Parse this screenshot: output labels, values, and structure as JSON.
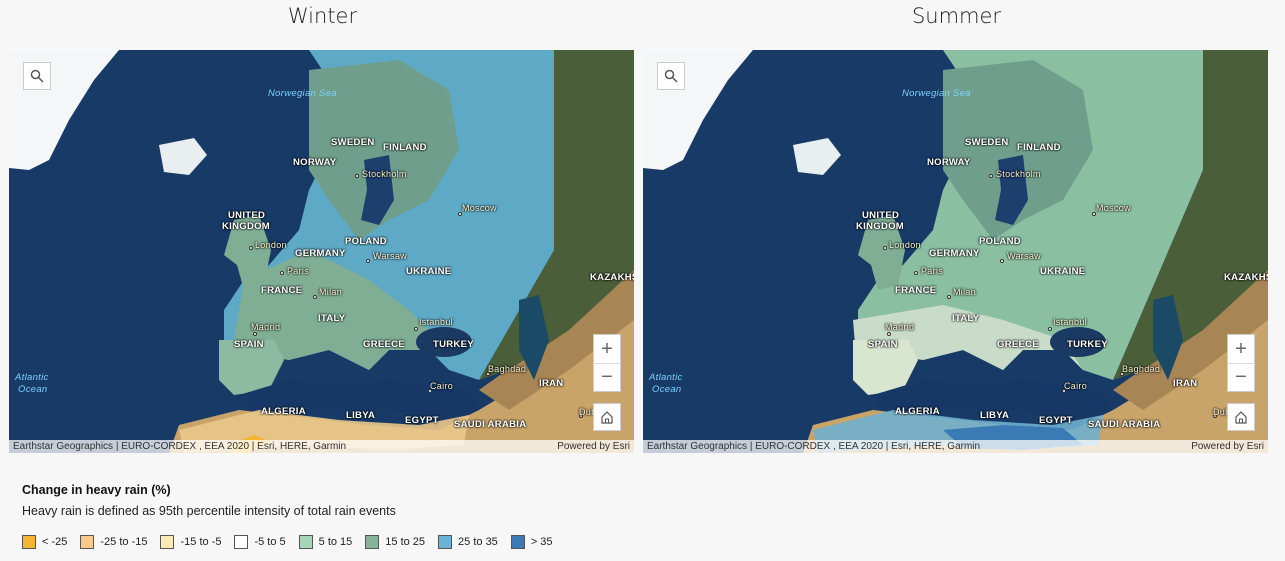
{
  "panels": [
    {
      "title": "Winter",
      "search_icon": "search-icon",
      "attribution": "Earthstar Geographics | EURO-CORDEX , EEA 2020 | Esri, HERE, Garmin",
      "powered_by": "Powered by Esri",
      "zoom_in": "+",
      "zoom_out": "−",
      "home_icon": "home-icon",
      "overlay_main_class": "25 to 35",
      "overlay_south_class": "< -25"
    },
    {
      "title": "Summer",
      "search_icon": "search-icon",
      "attribution": "Earthstar Geographics | EURO-CORDEX , EEA 2020 | Esri, HERE, Garmin",
      "powered_by": "Powered by Esri",
      "zoom_in": "+",
      "zoom_out": "−",
      "home_icon": "home-icon",
      "overlay_main_class": "5 to 15",
      "overlay_south_class": "25 to 35"
    }
  ],
  "map_labels": {
    "norwegian_sea": "Norwegian Sea",
    "sweden": "SWEDEN",
    "finland": "FINLAND",
    "norway": "NORWAY",
    "stockholm": "Stockholm",
    "moscow": "Moscow",
    "united": "UNITED",
    "kingdom": "KINGDOM",
    "london": "London",
    "poland": "POLAND",
    "germany": "GERMANY",
    "warsaw": "Warsaw",
    "paris": "Paris",
    "ukraine": "UKRAINE",
    "kazakh": "KAZAKHS",
    "france": "FRANCE",
    "milan": "Milan",
    "italy": "ITALY",
    "istanbul": "Istanbul",
    "madrid": "Madrid",
    "spain": "SPAIN",
    "greece": "GREECE",
    "turkey": "TURKEY",
    "atlantic": "Atlantic",
    "ocean": "Ocean",
    "baghdad": "Baghdad",
    "iran": "IRAN",
    "cairo": "Cairo",
    "algeria": "ALGERIA",
    "libya": "LIBYA",
    "egypt": "EGYPT",
    "dubai": "Dubai",
    "saudi": "SAUDI ARABIA"
  },
  "legend": {
    "title": "Change in heavy rain (%)",
    "description": "Heavy rain is defined as 95th percentile intensity of total rain events",
    "items": [
      {
        "label": "< -25",
        "color": "#f2b632"
      },
      {
        "label": "-25 to -15",
        "color": "#f7c98a"
      },
      {
        "label": "-15 to -5",
        "color": "#fbe9b7"
      },
      {
        "label": "-5 to 5",
        "color": "#ffffff"
      },
      {
        "label": "5 to 15",
        "color": "#a5d6b9"
      },
      {
        "label": "15 to 25",
        "color": "#86b39a"
      },
      {
        "label": "25 to 35",
        "color": "#6bb3d6"
      },
      {
        "label": "> 35",
        "color": "#3a7ab5"
      }
    ]
  }
}
